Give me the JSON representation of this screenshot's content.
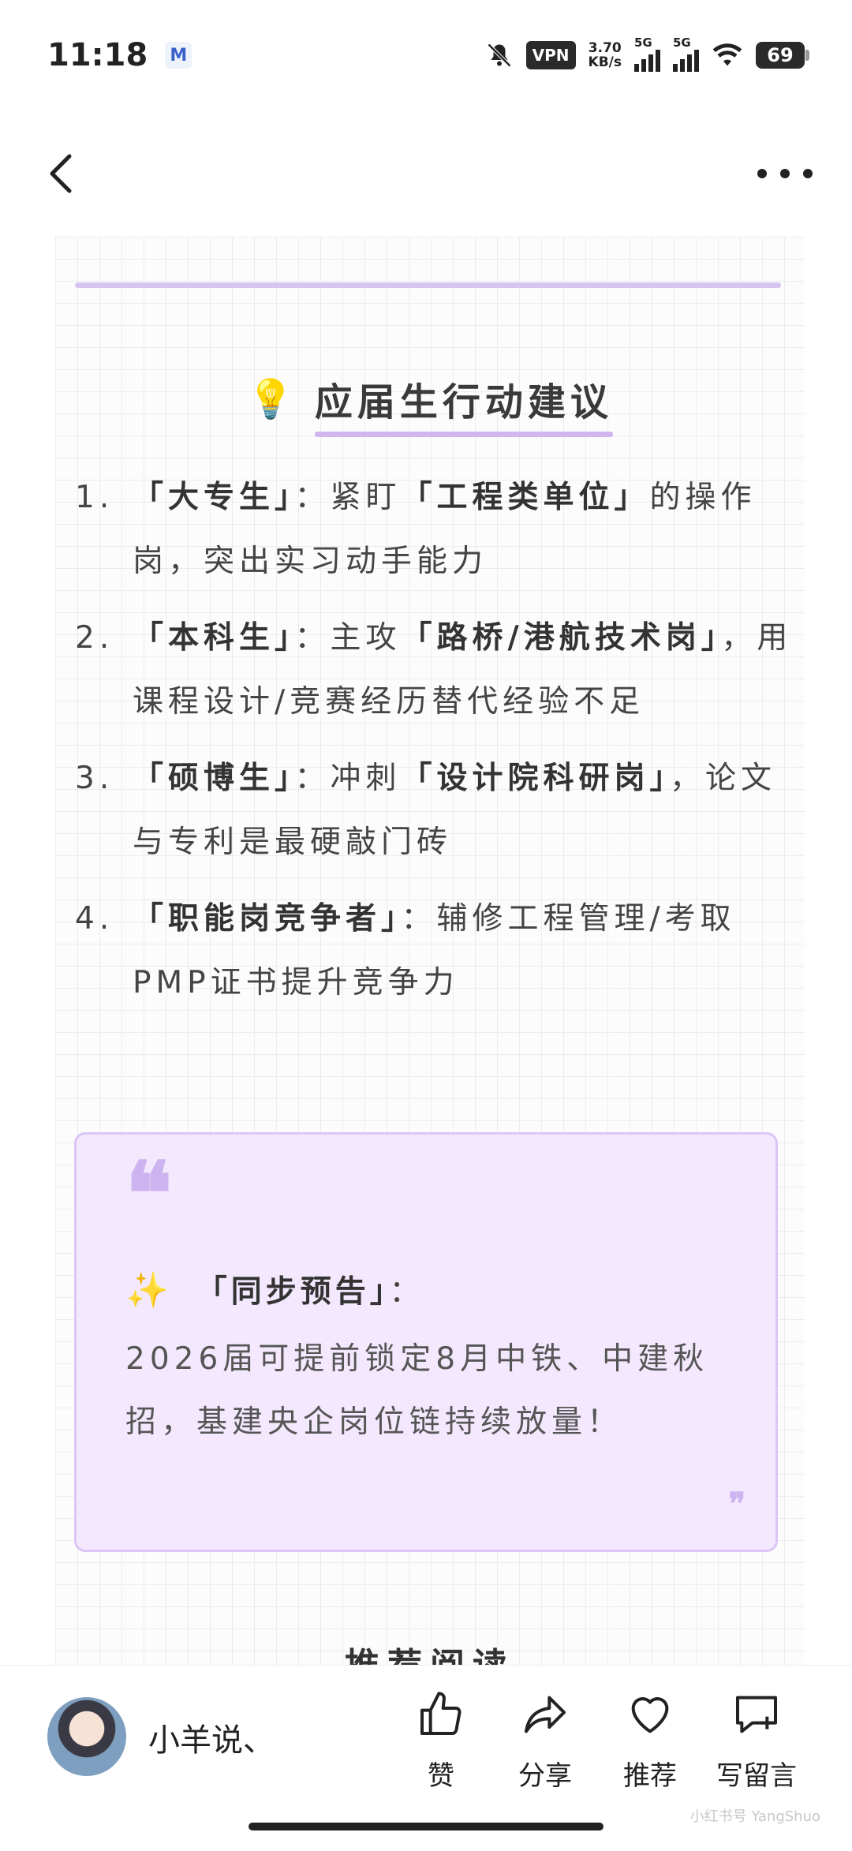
{
  "status": {
    "time": "11:18",
    "app_badge": "M",
    "vpn": "VPN",
    "net_speed_value": "3.70",
    "net_speed_unit": "KB/s",
    "sim1": "5G",
    "sim2": "5G",
    "battery": "69",
    "icons": [
      "mute-bell-icon",
      "wifi-icon",
      "signal-icon"
    ]
  },
  "nav": {
    "back_icon": "chevron-left-icon",
    "more_icon": "ellipsis-icon"
  },
  "section": {
    "emoji": "💡",
    "title": "应届生行动建议"
  },
  "actions": [
    {
      "num": "1.",
      "bold1": "「大专生」",
      "text1": "：紧盯",
      "bold2": "「工程类单位」",
      "text2": "的操作岗，突出实习动手能力"
    },
    {
      "num": "2.",
      "bold1": "「本科生」",
      "text1": "：主攻",
      "bold2": "「路桥/港航技术岗」",
      "text2": "，用课程设计/竞赛经历替代经验不足"
    },
    {
      "num": "3.",
      "bold1": "「硕博生」",
      "text1": "：冲刺",
      "bold2": "「设计院科研岗」",
      "text2": "，论文与专利是最硬敲门砖"
    },
    {
      "num": "4.",
      "bold1": "「职能岗竞争者」",
      "text1": "：辅修工程管理/考取PMP证书提升竞争力",
      "bold2": "",
      "text2": ""
    }
  ],
  "callout": {
    "open_quote": "❝",
    "close_quote": "❞",
    "sparkle": "✨",
    "head": "「同步预告」",
    "colon": "：",
    "body": "2026届可提前锁定8月中铁、中建秋招，基建央企岗位链持续放量！"
  },
  "recommend_heading": "推荐阅读",
  "bottom": {
    "author": "小羊说、",
    "like": "赞",
    "share": "分享",
    "recommend": "推荐",
    "comment": "写留言",
    "watermark": "小红书号 YangShuo"
  },
  "colors": {
    "accent": "#d8c4f0",
    "callout_bg": "#f3e8fd",
    "callout_border": "#dcc6f5"
  }
}
